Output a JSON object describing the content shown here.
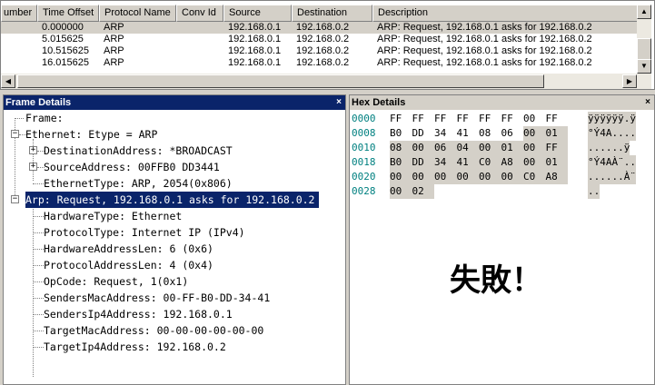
{
  "frame_list": {
    "columns": [
      "umber",
      "Time Offset",
      "Protocol Name",
      "Conv Id",
      "Source",
      "Destination",
      "Description"
    ],
    "rows": [
      {
        "time": "0.000000",
        "protocol": "ARP",
        "conv": "",
        "source": "192.168.0.1",
        "destination": "192.168.0.2",
        "description": "ARP: Request, 192.168.0.1 asks for 192.168.0.2",
        "selected": true
      },
      {
        "time": "5.015625",
        "protocol": "ARP",
        "conv": "",
        "source": "192.168.0.1",
        "destination": "192.168.0.2",
        "description": "ARP: Request, 192.168.0.1 asks for 192.168.0.2",
        "selected": false
      },
      {
        "time": "10.515625",
        "protocol": "ARP",
        "conv": "",
        "source": "192.168.0.1",
        "destination": "192.168.0.2",
        "description": "ARP: Request, 192.168.0.1 asks for 192.168.0.2",
        "selected": false
      },
      {
        "time": "16.015625",
        "protocol": "ARP",
        "conv": "",
        "source": "192.168.0.1",
        "destination": "192.168.0.2",
        "description": "ARP: Request, 192.168.0.1 asks for 192.168.0.2",
        "selected": false
      }
    ],
    "scroll_up_icon": "▲",
    "scroll_down_icon": "▼",
    "scroll_left_icon": "◀",
    "scroll_right_icon": "▶"
  },
  "frame_details": {
    "title": "Frame Details",
    "close": "×",
    "tree": [
      "Frame:",
      "Ethernet: Etype = ARP",
      "DestinationAddress: *BROADCAST",
      "SourceAddress: 00FFB0 DD3441",
      "EthernetType: ARP, 2054(0x806)",
      "Arp: Request, 192.168.0.1 asks for 192.168.0.2",
      "HardwareType: Ethernet",
      "ProtocolType: Internet IP (IPv4)",
      "HardwareAddressLen: 6 (0x6)",
      "ProtocolAddressLen: 4 (0x4)",
      "OpCode: Request, 1(0x1)",
      "SendersMacAddress: 00-FF-B0-DD-34-41",
      "SendersIp4Address: 192.168.0.1",
      "TargetMacAddress: 00-00-00-00-00-00",
      "TargetIp4Address: 192.168.0.2"
    ],
    "expander_minus": "−",
    "expander_plus": "+"
  },
  "hex_details": {
    "title": "Hex Details",
    "close": "×",
    "rows": [
      {
        "offset": "0000",
        "bytes": [
          "FF",
          "FF",
          "FF",
          "FF",
          "FF",
          "FF",
          "00",
          "FF"
        ],
        "ascii": "ÿÿÿÿÿÿ.ÿ"
      },
      {
        "offset": "0008",
        "bytes": [
          "B0",
          "DD",
          "34",
          "41",
          "08",
          "06",
          "00",
          "01"
        ],
        "ascii": "°Ý4A...."
      },
      {
        "offset": "0010",
        "bytes": [
          "08",
          "00",
          "06",
          "04",
          "00",
          "01",
          "00",
          "FF"
        ],
        "ascii": "......ÿ"
      },
      {
        "offset": "0018",
        "bytes": [
          "B0",
          "DD",
          "34",
          "41",
          "C0",
          "A8",
          "00",
          "01"
        ],
        "ascii": "°Ý4AÀ¨.."
      },
      {
        "offset": "0020",
        "bytes": [
          "00",
          "00",
          "00",
          "00",
          "00",
          "00",
          "C0",
          "A8"
        ],
        "ascii": "......À¨"
      },
      {
        "offset": "0028",
        "bytes": [
          "00",
          "02"
        ],
        "ascii": ".."
      }
    ],
    "fail_message": "失敗！"
  }
}
